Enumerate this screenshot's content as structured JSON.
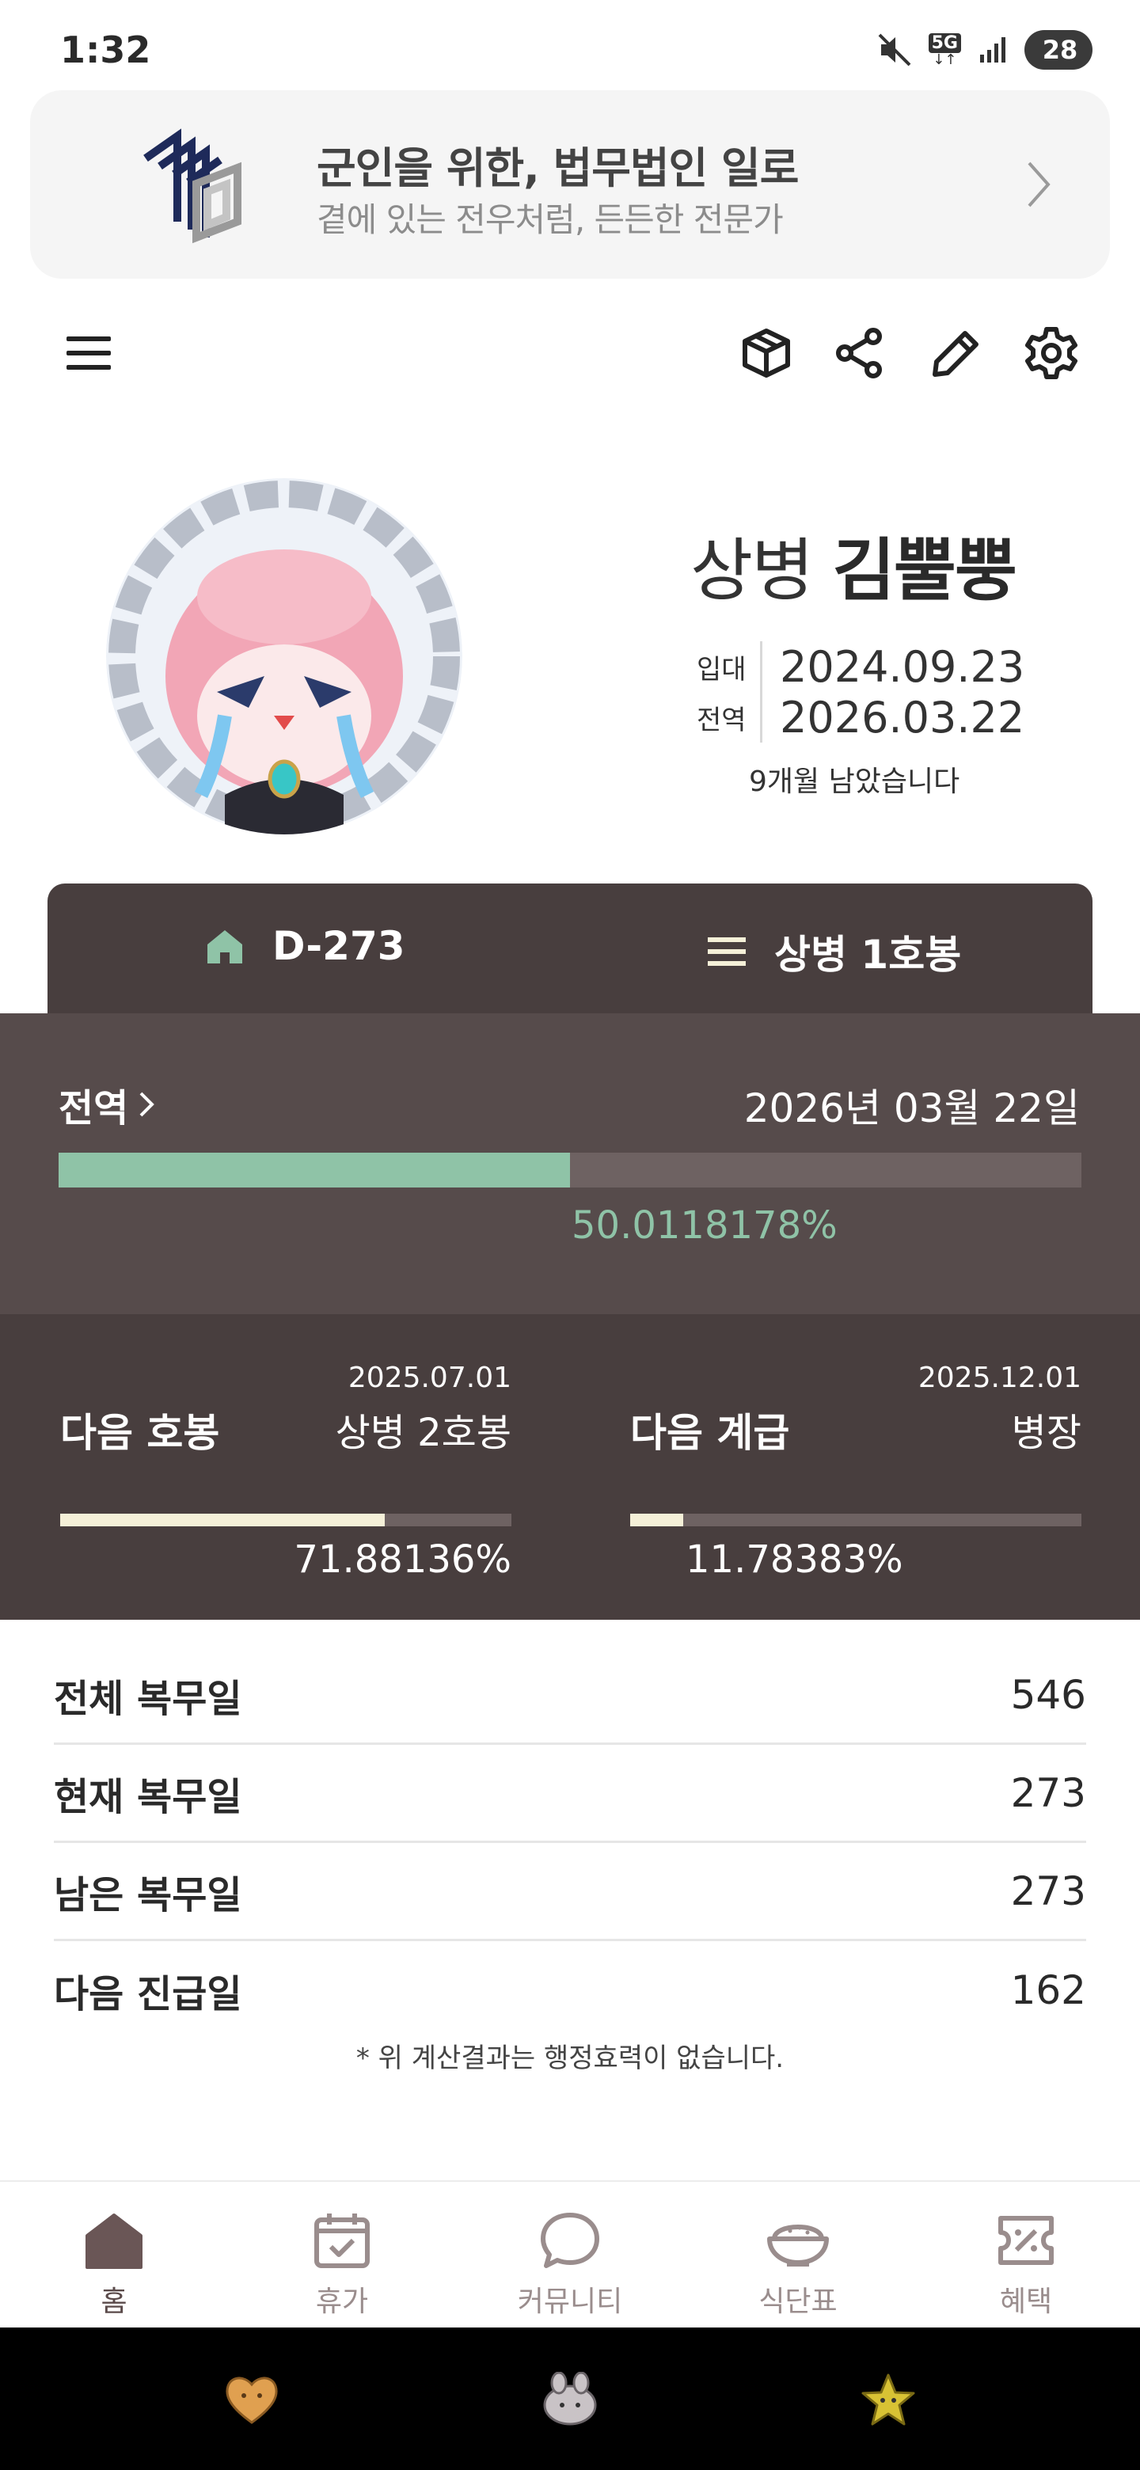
{
  "status_bar": {
    "time": "1:32",
    "network": "5G",
    "battery": "28"
  },
  "banner": {
    "title": "군인을 위한, 법무법인 일로",
    "subtitle": "곁에 있는 전우처럼, 든든한 전문가"
  },
  "toolbar": {
    "icons": [
      "menu-icon",
      "box-icon",
      "share-icon",
      "pencil-icon",
      "gear-icon"
    ]
  },
  "profile": {
    "rank": "상병",
    "name": "김뿔뿡",
    "enlist_label": "입대",
    "enlist_date": "2024.09.23",
    "discharge_label": "전역",
    "discharge_date": "2026.03.22",
    "remaining_text": "9개월 남았습니다"
  },
  "tabs": {
    "dday": "D-273",
    "grade": "상병 1호봉"
  },
  "discharge_panel": {
    "label": "전역",
    "date": "2026년 03월 22일",
    "progress_fraction": 0.500118178,
    "percent_text": "50.0118178%"
  },
  "next_step": {
    "date": "2025.07.01",
    "label": "다음 호봉",
    "target": "상병 2호봉",
    "progress_fraction": 0.7188136,
    "percent_text": "71.88136%"
  },
  "next_rank": {
    "date": "2025.12.01",
    "label": "다음 계급",
    "target": "병장",
    "progress_fraction": 0.1178383,
    "percent_text": "11.78383%"
  },
  "stats": [
    {
      "label": "전체 복무일",
      "value": "546"
    },
    {
      "label": "현재 복무일",
      "value": "273"
    },
    {
      "label": "남은 복무일",
      "value": "273"
    },
    {
      "label": "다음 진급일",
      "value": "162"
    }
  ],
  "disclaimer": "* 위 계산결과는 행정효력이 없습니다.",
  "bottom_nav": [
    {
      "label": "홈",
      "icon": "home-icon",
      "active": true
    },
    {
      "label": "휴가",
      "icon": "calendar-icon",
      "active": false
    },
    {
      "label": "커뮤니티",
      "icon": "chat-bubble-icon",
      "active": false
    },
    {
      "label": "식단표",
      "icon": "rice-bowl-icon",
      "active": false
    },
    {
      "label": "혜택",
      "icon": "coupon-icon",
      "active": false
    }
  ],
  "colors": {
    "panel_dark": "#483e3e",
    "panel_mid": "#564b4b",
    "accent_green": "#8fc3a7",
    "bar_cream": "#f5f0d8"
  }
}
